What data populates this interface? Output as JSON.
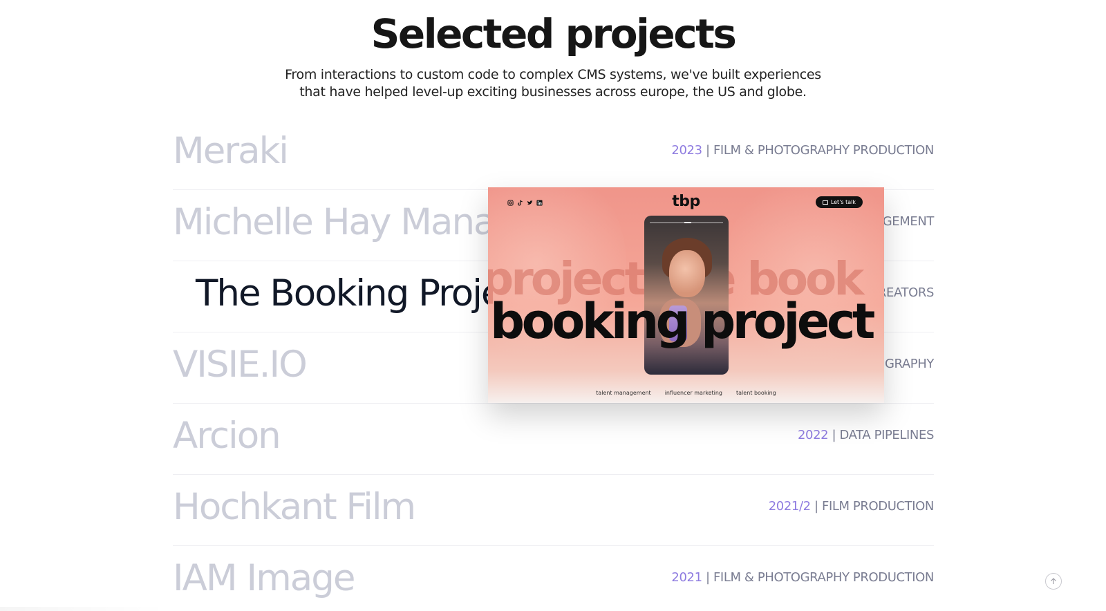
{
  "header": {
    "title": "Selected projects",
    "subtitle_line1": "From interactions to custom code to complex CMS systems, we've built experiences",
    "subtitle_line2": "that have helped level-up exciting businesses across europe, the US and globe."
  },
  "projects": [
    {
      "name": "Meraki",
      "year": "2023",
      "category": "FILM & PHOTOGRAPHY PRODUCTION",
      "active": false
    },
    {
      "name": "Michelle Hay Manag",
      "year": "",
      "category": "GEMENT",
      "active": false
    },
    {
      "name": "The Booking Projec",
      "year": "",
      "category": "REATORS",
      "active": true
    },
    {
      "name": "VISIE.IO",
      "year": "",
      "category": "GRAPHY",
      "active": false
    },
    {
      "name": "Arcion",
      "year": "2022",
      "category": "DATA PIPELINES",
      "active": false
    },
    {
      "name": "Hochkant Film",
      "year": "2021/2",
      "category": "FILM PRODUCTION",
      "active": false
    },
    {
      "name": "IAM Image",
      "year": "2021",
      "category": "FILM & PHOTOGRAPHY PRODUCTION",
      "active": false
    }
  ],
  "separator": " | ",
  "preview": {
    "brand": "tbp",
    "cta_label": "Let's talk",
    "ghost_text": "project the book",
    "headline": "booking project",
    "tags": [
      "talent management",
      "influencer marketing",
      "talent booking"
    ],
    "social_icons": [
      "instagram-icon",
      "tiktok-icon",
      "twitter-icon",
      "linkedin-icon"
    ]
  },
  "scroll_top_icon": "arrow-up-icon",
  "colors": {
    "muted_name": "#cbcdd8",
    "active_name": "#111827",
    "year": "#8f7ce0",
    "category": "#7a7d92",
    "preview_bg": "#f0958a"
  }
}
